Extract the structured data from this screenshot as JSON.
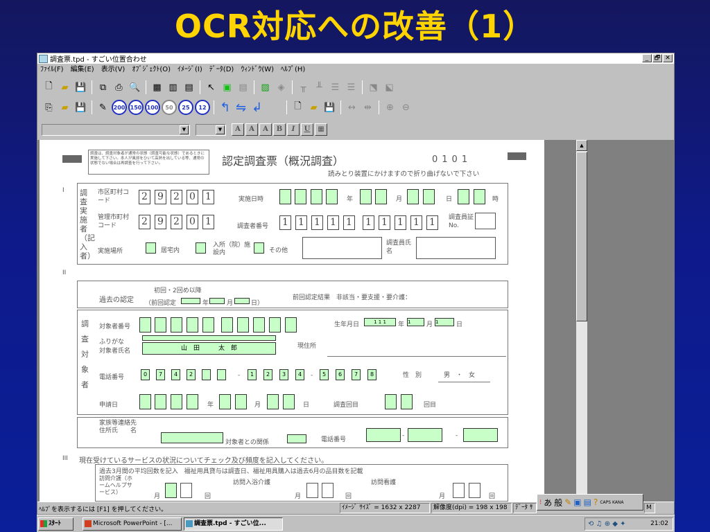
{
  "slide": {
    "title": "OCR対応への改善（1）"
  },
  "window": {
    "title": "調査票.tpd - すごい位置合わせ",
    "controls": {
      "minimize": "_",
      "maximize": "🗗",
      "close": "✕"
    }
  },
  "menu": [
    "ﾌｧｲﾙ(F)",
    "編集(E)",
    "表示(V)",
    "ｵﾌﾞｼﾞｪｸﾄ(O)",
    "ｲﾒｰｼﾞ(I)",
    "ﾃﾞｰﾀ(D)",
    "ｳｨﾝﾄﾞｳ(W)",
    "ﾍﾙﾌﾟ(H)"
  ],
  "toolbar2": {
    "zoom_200": "200",
    "zoom_150": "150",
    "zoom_100": "100",
    "zoom_50": "50",
    "zoom_25": "25",
    "zoom_12": "12"
  },
  "toolbar3": {
    "font_larger": "A",
    "font_smaller": "A",
    "font_reset": "A",
    "bold": "B",
    "italic": "I",
    "underline": "U"
  },
  "form": {
    "instruction": "調査は、調査対象者が通常の状態（調査可能な状態）であるときに実施して下さい。本人が風邪をひいて高熱を出している等、通常の状態でない場合は再調査を行って下さい。",
    "title": "認定調査票（概況調査）",
    "form_number": "0101",
    "notice": "読みとり装置にかけますので折り曲げないで下さい",
    "section1_roman": "I",
    "section1_label": "調査実施者（記入者）",
    "municipality_code_label": "市区町村コード",
    "municipality_code": [
      "2",
      "9",
      "2",
      "0",
      "1"
    ],
    "insurer_code_label": "管理市町村コード",
    "insurer_code": [
      "2",
      "9",
      "2",
      "0",
      "1"
    ],
    "date_label": "実施日時",
    "year": "年",
    "month": "月",
    "day": "日",
    "hour": "時",
    "investigator_no_label": "調査者番号",
    "investigator_no": [
      "1",
      "1",
      "1",
      "1",
      "1",
      "1",
      "1",
      "1",
      "1",
      "1"
    ],
    "investigator_id_label": "調査員証 No.",
    "place_label": "実施場所",
    "place_home": "居宅内",
    "place_facility": "入所（院）施設内",
    "place_other": "その他",
    "investigator_name_label": "調査員氏名",
    "section2_roman": "II",
    "prior_cert_label": "過去の認定",
    "prior_cert_options": "初回・2回め以降",
    "prior_cert_date": "（前回認定",
    "prior_cert_date_close": "日）",
    "prior_result_label": "前回認定結果　非該当・要支援・要介護：",
    "subject_label": "調査対象者",
    "subject_no_label": "対象者番号",
    "birth_label": "生年月日",
    "birth_year": "1 1 1",
    "birth_month": "1",
    "birth_day": "1",
    "furigana_label": "ふりがな",
    "name_label": "対象者氏名",
    "name_value": "山　田　　　太　郎",
    "address_label": "現住所",
    "phone_label": "電話番号",
    "phone_group1": [
      "0",
      "7",
      "4",
      "2",
      "",
      ""
    ],
    "phone_group2": [
      "1",
      "2",
      "3",
      "4"
    ],
    "phone_group3": [
      "5",
      "6",
      "7",
      "8"
    ],
    "gender_label": "性　別",
    "gender_options": "男　・　女",
    "apply_date_label": "申請日",
    "survey_count_label": "調査回目",
    "survey_count_unit": "回目",
    "family_label": "家族等連絡先住所氏　　名",
    "relation_label": "対象者との関係",
    "family_phone_label": "電話番号",
    "section3_roman": "III",
    "section3_title": "現在受けているサービスの状況についてチェック及び頻度を記入してください。",
    "section3_note": "過去3月間の平均回数を記入　福祉用具貸与は調査日、福祉用具購入は過去6月の品目数を記載",
    "home_help_label": "訪問介護（ホームヘルプサービス）",
    "bath_label": "訪問入浴介護",
    "nursing_label": "訪問看護",
    "per_month": "月",
    "times": "回"
  },
  "status": {
    "message": "ﾍﾙﾌﾟを表示するには [F1] を押してください。",
    "image_size": "ｲﾒｰｼﾞ ｻｲｽﾞ = 1632 x 2287",
    "resolution": "解像度(dpi) = 198 x 198",
    "data": "ﾃﾞｰﾀ ｻ",
    "mode": "M"
  },
  "ime": {
    "kana": "あ",
    "mode": "般",
    "caps": "CAPS\nKANA"
  },
  "taskbar": {
    "start": "ｽﾀｰﾄ",
    "tasks": [
      "Microsoft PowerPoint - [...",
      "調査票.tpd - すごい位..."
    ],
    "clock": "21:02"
  }
}
